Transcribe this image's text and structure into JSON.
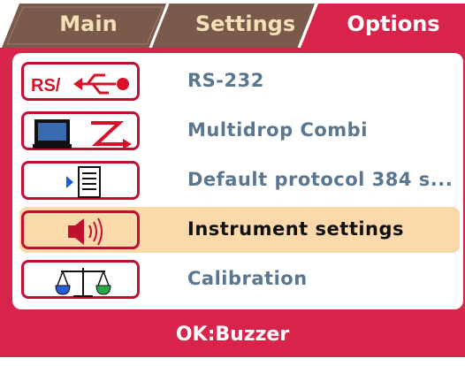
{
  "tabs": [
    {
      "label": "Main",
      "active": false
    },
    {
      "label": "Settings",
      "active": false
    },
    {
      "label": "Options",
      "active": true
    }
  ],
  "menu": {
    "items": [
      {
        "label": "RS-232",
        "icon": "rs232-usb-icon",
        "selected": false
      },
      {
        "label": "Multidrop Combi",
        "icon": "monitor-multidrop-icon",
        "selected": false
      },
      {
        "label": "Default protocol 384 s...",
        "icon": "protocol-list-icon",
        "selected": false
      },
      {
        "label": "Instrument settings",
        "icon": "speaker-icon",
        "selected": true
      },
      {
        "label": "Calibration",
        "icon": "balance-scale-icon",
        "selected": false
      }
    ],
    "icon_text": {
      "rs": "RS/"
    }
  },
  "status": {
    "text": "OK:Buzzer"
  },
  "colors": {
    "frame": "#d8244a",
    "active_tab": "#d8244a",
    "inactive_tab": "#7a5a4a",
    "selection": "#fbd9aa",
    "item_text": "#5a7690"
  }
}
